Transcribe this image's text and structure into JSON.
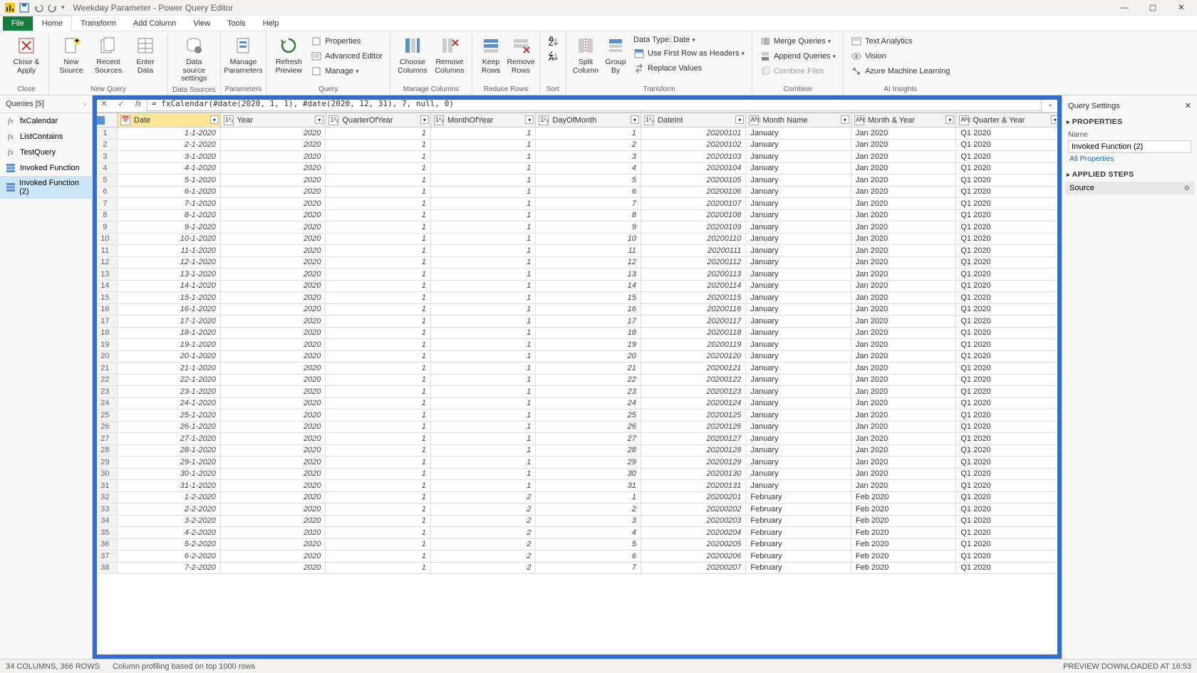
{
  "title": "Weekday Parameter - Power Query Editor",
  "menutabs": [
    "File",
    "Home",
    "Transform",
    "Add Column",
    "View",
    "Tools",
    "Help"
  ],
  "active_tab": "Home",
  "ribbon": {
    "close": {
      "close_apply": "Close &\nApply",
      "group": "Close"
    },
    "newquery": {
      "new_source": "New\nSource",
      "recent": "Recent\nSources",
      "enter": "Enter\nData",
      "group": "New Query"
    },
    "datasources": {
      "settings": "Data source\nsettings",
      "group": "Data Sources"
    },
    "parameters": {
      "manage": "Manage\nParameters",
      "group": "Parameters"
    },
    "query": {
      "refresh": "Refresh\nPreview",
      "properties": "Properties",
      "advanced": "Advanced Editor",
      "manage": "Manage",
      "group": "Query"
    },
    "managecols": {
      "choose": "Choose\nColumns",
      "remove": "Remove\nColumns",
      "group": "Manage Columns"
    },
    "reducerows": {
      "keep": "Keep\nRows",
      "remove": "Remove\nRows",
      "group": "Reduce Rows"
    },
    "sort": {
      "group": "Sort"
    },
    "transform": {
      "split": "Split\nColumn",
      "groupby": "Group\nBy",
      "datatype": "Data Type: Date",
      "firstrow": "Use First Row as Headers",
      "replace": "Replace Values",
      "group": "Transform"
    },
    "combine": {
      "merge": "Merge Queries",
      "append": "Append Queries",
      "combinefiles": "Combine Files",
      "group": "Combine"
    },
    "ai": {
      "text": "Text Analytics",
      "vision": "Vision",
      "ml": "Azure Machine Learning",
      "group": "AI Insights"
    }
  },
  "formula": "= fxCalendar(#date(2020, 1, 1), #date(2020, 12, 31), 7, null, 0)",
  "queries": {
    "header": "Queries [5]",
    "items": [
      "fxCalendar",
      "ListContains",
      "TestQuery",
      "Invoked Function",
      "Invoked Function (2)"
    ],
    "selected": 4
  },
  "columns": [
    "Date",
    "Year",
    "QuarterOfYear",
    "MonthOfYear",
    "DayOfMonth",
    "DateInt",
    "Month Name",
    "Month & Year",
    "Quarter & Year"
  ],
  "col_icons": [
    "📅",
    "1²₃",
    "1²₃",
    "1²₃",
    "1²₃",
    "1²₃",
    "Aᴮc",
    "Aᴮc",
    "Aᴮc"
  ],
  "selected_col": 0,
  "rows": [
    [
      "1-1-2020",
      "2020",
      "1",
      "1",
      "1",
      "20200101",
      "January",
      "Jan 2020",
      "Q1 2020"
    ],
    [
      "2-1-2020",
      "2020",
      "1",
      "1",
      "2",
      "20200102",
      "January",
      "Jan 2020",
      "Q1 2020"
    ],
    [
      "3-1-2020",
      "2020",
      "1",
      "1",
      "3",
      "20200103",
      "January",
      "Jan 2020",
      "Q1 2020"
    ],
    [
      "4-1-2020",
      "2020",
      "1",
      "1",
      "4",
      "20200104",
      "January",
      "Jan 2020",
      "Q1 2020"
    ],
    [
      "5-1-2020",
      "2020",
      "1",
      "1",
      "5",
      "20200105",
      "January",
      "Jan 2020",
      "Q1 2020"
    ],
    [
      "6-1-2020",
      "2020",
      "1",
      "1",
      "6",
      "20200106",
      "January",
      "Jan 2020",
      "Q1 2020"
    ],
    [
      "7-1-2020",
      "2020",
      "1",
      "1",
      "7",
      "20200107",
      "January",
      "Jan 2020",
      "Q1 2020"
    ],
    [
      "8-1-2020",
      "2020",
      "1",
      "1",
      "8",
      "20200108",
      "January",
      "Jan 2020",
      "Q1 2020"
    ],
    [
      "9-1-2020",
      "2020",
      "1",
      "1",
      "9",
      "20200109",
      "January",
      "Jan 2020",
      "Q1 2020"
    ],
    [
      "10-1-2020",
      "2020",
      "1",
      "1",
      "10",
      "20200110",
      "January",
      "Jan 2020",
      "Q1 2020"
    ],
    [
      "11-1-2020",
      "2020",
      "1",
      "1",
      "11",
      "20200111",
      "January",
      "Jan 2020",
      "Q1 2020"
    ],
    [
      "12-1-2020",
      "2020",
      "1",
      "1",
      "12",
      "20200112",
      "January",
      "Jan 2020",
      "Q1 2020"
    ],
    [
      "13-1-2020",
      "2020",
      "1",
      "1",
      "13",
      "20200113",
      "January",
      "Jan 2020",
      "Q1 2020"
    ],
    [
      "14-1-2020",
      "2020",
      "1",
      "1",
      "14",
      "20200114",
      "January",
      "Jan 2020",
      "Q1 2020"
    ],
    [
      "15-1-2020",
      "2020",
      "1",
      "1",
      "15",
      "20200115",
      "January",
      "Jan 2020",
      "Q1 2020"
    ],
    [
      "16-1-2020",
      "2020",
      "1",
      "1",
      "16",
      "20200116",
      "January",
      "Jan 2020",
      "Q1 2020"
    ],
    [
      "17-1-2020",
      "2020",
      "1",
      "1",
      "17",
      "20200117",
      "January",
      "Jan 2020",
      "Q1 2020"
    ],
    [
      "18-1-2020",
      "2020",
      "1",
      "1",
      "18",
      "20200118",
      "January",
      "Jan 2020",
      "Q1 2020"
    ],
    [
      "19-1-2020",
      "2020",
      "1",
      "1",
      "19",
      "20200119",
      "January",
      "Jan 2020",
      "Q1 2020"
    ],
    [
      "20-1-2020",
      "2020",
      "1",
      "1",
      "20",
      "20200120",
      "January",
      "Jan 2020",
      "Q1 2020"
    ],
    [
      "21-1-2020",
      "2020",
      "1",
      "1",
      "21",
      "20200121",
      "January",
      "Jan 2020",
      "Q1 2020"
    ],
    [
      "22-1-2020",
      "2020",
      "1",
      "1",
      "22",
      "20200122",
      "January",
      "Jan 2020",
      "Q1 2020"
    ],
    [
      "23-1-2020",
      "2020",
      "1",
      "1",
      "23",
      "20200123",
      "January",
      "Jan 2020",
      "Q1 2020"
    ],
    [
      "24-1-2020",
      "2020",
      "1",
      "1",
      "24",
      "20200124",
      "January",
      "Jan 2020",
      "Q1 2020"
    ],
    [
      "25-1-2020",
      "2020",
      "1",
      "1",
      "25",
      "20200125",
      "January",
      "Jan 2020",
      "Q1 2020"
    ],
    [
      "26-1-2020",
      "2020",
      "1",
      "1",
      "26",
      "20200126",
      "January",
      "Jan 2020",
      "Q1 2020"
    ],
    [
      "27-1-2020",
      "2020",
      "1",
      "1",
      "27",
      "20200127",
      "January",
      "Jan 2020",
      "Q1 2020"
    ],
    [
      "28-1-2020",
      "2020",
      "1",
      "1",
      "28",
      "20200128",
      "January",
      "Jan 2020",
      "Q1 2020"
    ],
    [
      "29-1-2020",
      "2020",
      "1",
      "1",
      "29",
      "20200129",
      "January",
      "Jan 2020",
      "Q1 2020"
    ],
    [
      "30-1-2020",
      "2020",
      "1",
      "1",
      "30",
      "20200130",
      "January",
      "Jan 2020",
      "Q1 2020"
    ],
    [
      "31-1-2020",
      "2020",
      "1",
      "1",
      "31",
      "20200131",
      "January",
      "Jan 2020",
      "Q1 2020"
    ],
    [
      "1-2-2020",
      "2020",
      "1",
      "2",
      "1",
      "20200201",
      "February",
      "Feb 2020",
      "Q1 2020"
    ],
    [
      "2-2-2020",
      "2020",
      "1",
      "2",
      "2",
      "20200202",
      "February",
      "Feb 2020",
      "Q1 2020"
    ],
    [
      "3-2-2020",
      "2020",
      "1",
      "2",
      "3",
      "20200203",
      "February",
      "Feb 2020",
      "Q1 2020"
    ],
    [
      "4-2-2020",
      "2020",
      "1",
      "2",
      "4",
      "20200204",
      "February",
      "Feb 2020",
      "Q1 2020"
    ],
    [
      "5-2-2020",
      "2020",
      "1",
      "2",
      "5",
      "20200205",
      "February",
      "Feb 2020",
      "Q1 2020"
    ],
    [
      "6-2-2020",
      "2020",
      "1",
      "2",
      "6",
      "20200206",
      "February",
      "Feb 2020",
      "Q1 2020"
    ],
    [
      "7-2-2020",
      "2020",
      "1",
      "2",
      "7",
      "20200207",
      "February",
      "Feb 2020",
      "Q1 2020"
    ]
  ],
  "settings": {
    "header": "Query Settings",
    "properties": "PROPERTIES",
    "name_label": "Name",
    "name_value": "Invoked Function (2)",
    "all_props": "All Properties",
    "applied": "APPLIED STEPS",
    "step": "Source"
  },
  "statusbar": {
    "left": "34 COLUMNS, 366 ROWS",
    "mid": "Column profiling based on top 1000 rows",
    "right": "PREVIEW DOWNLOADED AT 16:53"
  }
}
